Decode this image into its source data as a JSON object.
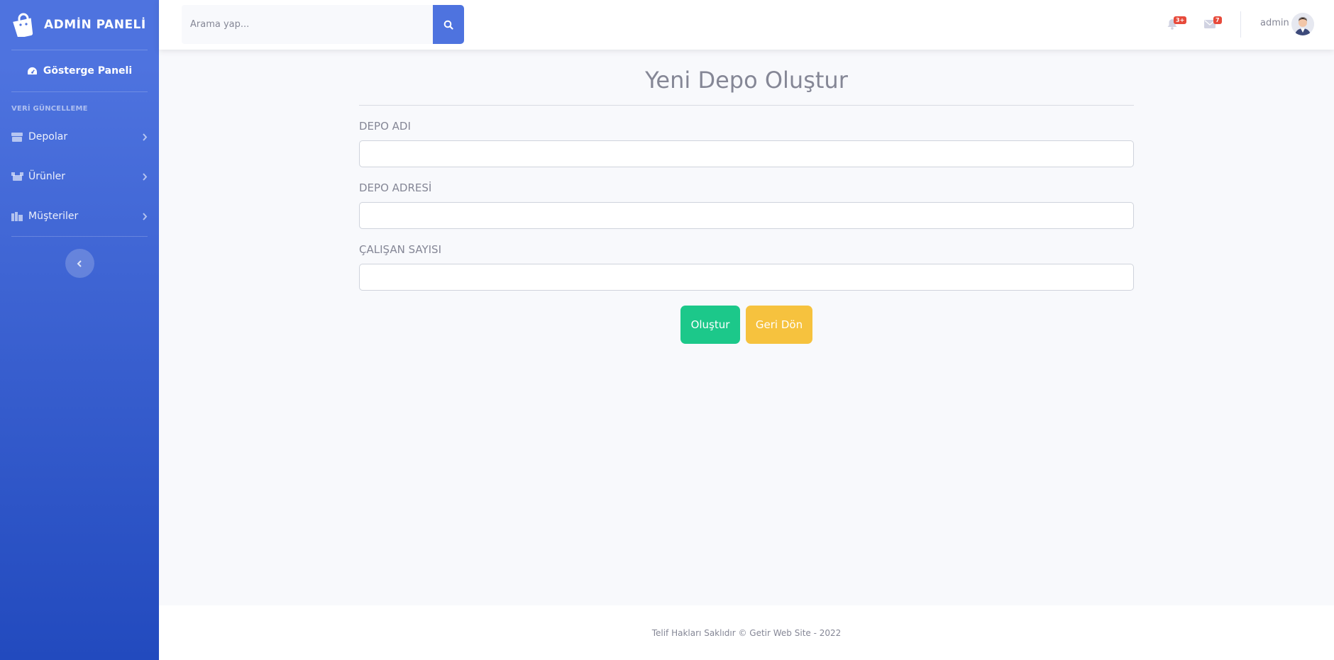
{
  "brand": {
    "title": "ADMİN PANELİ",
    "icon": "shopping-bag-icon"
  },
  "sidebar": {
    "dashboard_label": "Gösterge Paneli",
    "section_heading": "VERİ GÜNCELLEME",
    "items": [
      {
        "label": "Depolar",
        "icon": "warehouse-icon"
      },
      {
        "label": "Ürünler",
        "icon": "boxes-icon"
      },
      {
        "label": "Müşteriler",
        "icon": "users-icon"
      }
    ]
  },
  "topbar": {
    "search_placeholder": "Arama yap...",
    "alerts_badge": "3+",
    "messages_badge": "7",
    "user_name": "admin"
  },
  "form": {
    "title": "Yeni Depo Oluştur",
    "fields": [
      {
        "label": "DEPO ADI",
        "value": ""
      },
      {
        "label": "DEPO ADRESİ",
        "value": ""
      },
      {
        "label": "ÇALIŞAN SAYISI",
        "value": ""
      }
    ],
    "create_label": "Oluştur",
    "back_label": "Geri Dön"
  },
  "footer": {
    "text": "Telif Hakları Saklıdır © Getir Web Site - 2022"
  },
  "colors": {
    "primary": "#4e73df",
    "success": "#1cc88a",
    "warning": "#f6c23e",
    "danger": "#e74a3b"
  }
}
